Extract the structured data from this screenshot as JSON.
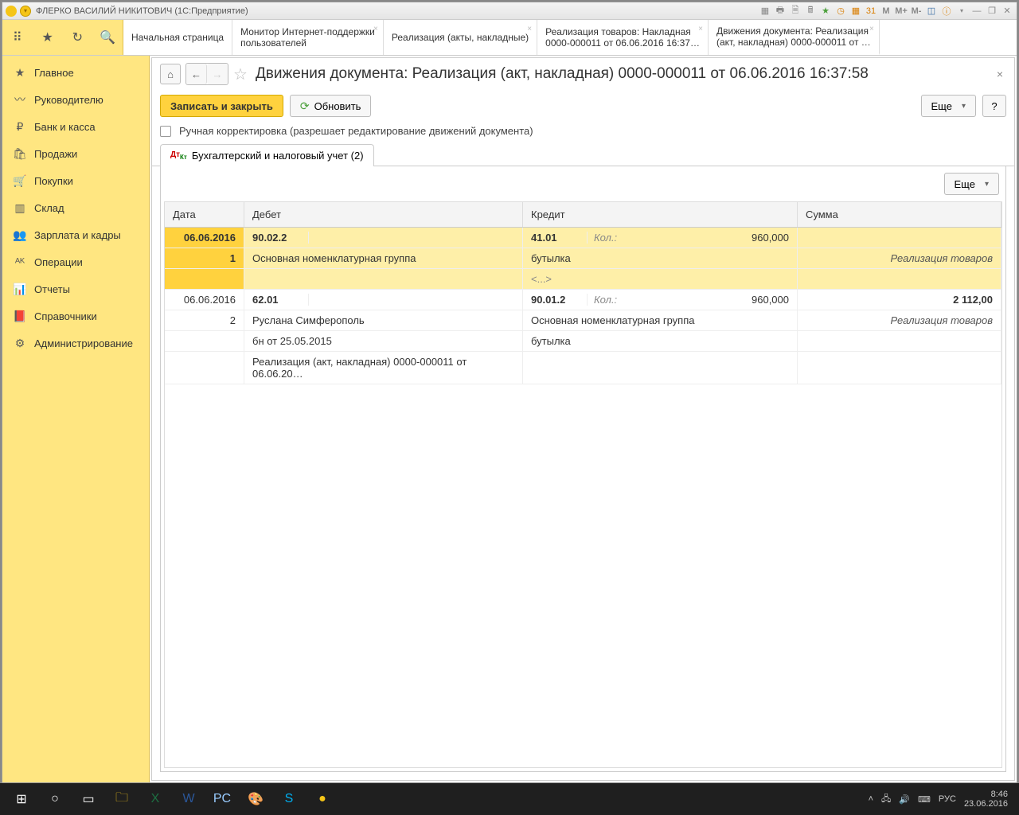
{
  "window": {
    "title": "ФЛЕРКО ВАСИЛИЙ НИКИТОВИЧ  (1С:Предприятие)"
  },
  "toolbar_m": {
    "m": "M",
    "mplus": "M+",
    "mminus": "M-"
  },
  "tabs": [
    {
      "l1": "Начальная страница",
      "l2": ""
    },
    {
      "l1": "Монитор Интернет-поддержки",
      "l2": "пользователей"
    },
    {
      "l1": "Реализация (акты, накладные)",
      "l2": ""
    },
    {
      "l1": "Реализация товаров: Накладная",
      "l2": "0000-000011 от 06.06.2016 16:37…"
    },
    {
      "l1": "Движения документа: Реализация",
      "l2": "(акт, накладная) 0000-000011 от …"
    }
  ],
  "sidebar": [
    {
      "icon": "★",
      "label": "Главное"
    },
    {
      "icon": "〰",
      "label": "Руководителю"
    },
    {
      "icon": "₽",
      "label": "Банк и касса"
    },
    {
      "icon": "🛍",
      "label": "Продажи"
    },
    {
      "icon": "🛒",
      "label": "Покупки"
    },
    {
      "icon": "▥",
      "label": "Склад"
    },
    {
      "icon": "👥",
      "label": "Зарплата и кадры"
    },
    {
      "icon": "ᴬᴷ",
      "label": "Операции"
    },
    {
      "icon": "📊",
      "label": "Отчеты"
    },
    {
      "icon": "📕",
      "label": "Справочники"
    },
    {
      "icon": "⚙",
      "label": "Администрирование"
    }
  ],
  "page": {
    "title": "Движения документа: Реализация (акт, накладная) 0000-000011 от 06.06.2016 16:37:58",
    "save_close": "Записать и закрыть",
    "refresh": "Обновить",
    "more": "Еще",
    "help": "?",
    "manual_edit": "Ручная корректировка (разрешает редактирование движений документа)",
    "tab_label": "Бухгалтерский и налоговый учет (2)"
  },
  "grid": {
    "headers": {
      "date": "Дата",
      "debit": "Дебет",
      "credit": "Кредит",
      "sum": "Сумма"
    },
    "more": "Еще",
    "qty_label": "Кол.:",
    "rows": [
      {
        "date": "06.06.2016",
        "n": "1",
        "deb_acct": "90.02.2",
        "deb_l1": "Основная номенклатурная группа",
        "cred_acct": "41.01",
        "cred_qty": "960,000",
        "cred_l1": "бутылка",
        "cred_l2": "<...>",
        "sum_l1": "",
        "sum_l2": "Реализация товаров"
      },
      {
        "date": "06.06.2016",
        "n": "2",
        "deb_acct": "62.01",
        "deb_l1": "Руслана Симферополь",
        "deb_l2": "бн от 25.05.2015",
        "deb_l3": "Реализация (акт, накладная) 0000-000011 от 06.06.20…",
        "cred_acct": "90.01.2",
        "cred_qty": "960,000",
        "cred_l1": "Основная номенклатурная группа",
        "cred_l2": "бутылка",
        "sum_l1": "2 112,00",
        "sum_l2": "Реализация товаров"
      }
    ]
  },
  "tray": {
    "lang": "РУС",
    "time": "8:46",
    "date": "23.06.2016"
  }
}
